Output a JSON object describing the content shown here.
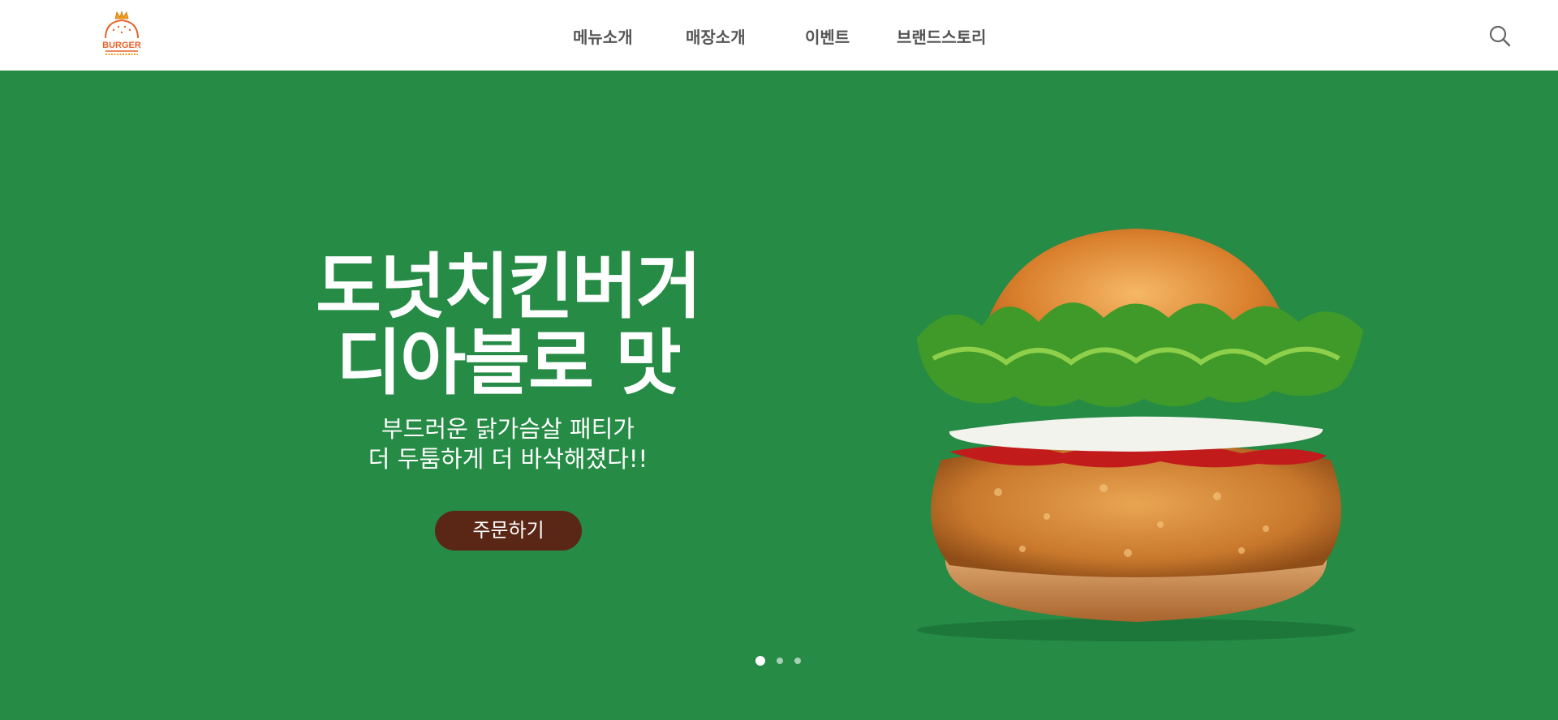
{
  "header": {
    "logo_text": "BURGER",
    "nav": [
      {
        "label": "메뉴소개"
      },
      {
        "label": "매장소개"
      },
      {
        "label": "이벤트"
      },
      {
        "label": "브랜드스토리"
      }
    ],
    "search_icon": "search-icon"
  },
  "hero": {
    "headline_line1": "도넛치킨버거",
    "headline_line2": "디아블로 맛",
    "sub_line1": "부드러운 닭가슴살 패티가",
    "sub_line2": "더 두툼하게 더 바삭해졌다!!",
    "order_label": "주문하기",
    "background_color": "#258b45",
    "button_color": "#5a2716",
    "image": "chicken-burger-image"
  },
  "carousel": {
    "count": 3,
    "active_index": 0
  }
}
